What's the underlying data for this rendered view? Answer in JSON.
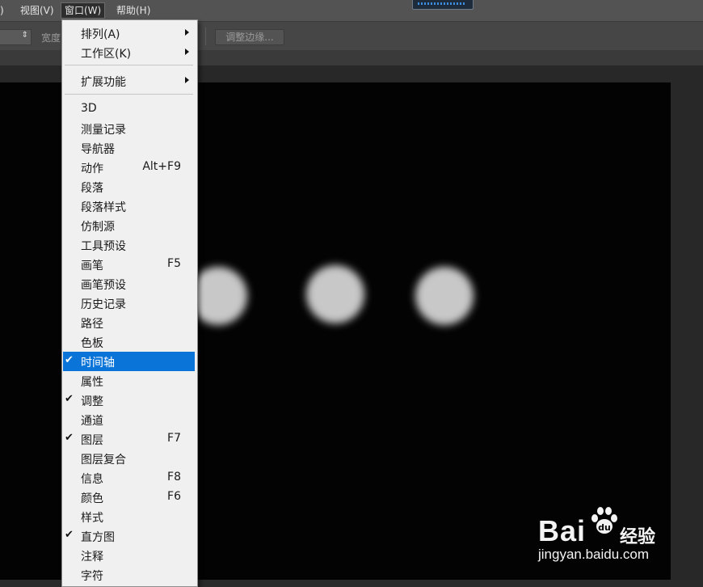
{
  "menubar": {
    "partial_item": ")",
    "view": "视图(V)",
    "window": "窗口(W)",
    "help": "帮助(H)"
  },
  "optionsbar": {
    "width_label": "宽度",
    "refine_edge": "调整边缘..."
  },
  "menu": {
    "top_items": [
      {
        "label": "排列(A)"
      },
      {
        "label": "工作区(K)"
      }
    ],
    "extensions": "扩展功能",
    "items": [
      {
        "label": "3D",
        "shortcut": "",
        "checked": false
      },
      {
        "label": "测量记录",
        "shortcut": "",
        "checked": false
      },
      {
        "label": "导航器",
        "shortcut": "",
        "checked": false
      },
      {
        "label": "动作",
        "shortcut": "Alt+F9",
        "checked": false
      },
      {
        "label": "段落",
        "shortcut": "",
        "checked": false
      },
      {
        "label": "段落样式",
        "shortcut": "",
        "checked": false
      },
      {
        "label": "仿制源",
        "shortcut": "",
        "checked": false
      },
      {
        "label": "工具预设",
        "shortcut": "",
        "checked": false
      },
      {
        "label": "画笔",
        "shortcut": "F5",
        "checked": false
      },
      {
        "label": "画笔预设",
        "shortcut": "",
        "checked": false
      },
      {
        "label": "历史记录",
        "shortcut": "",
        "checked": false
      },
      {
        "label": "路径",
        "shortcut": "",
        "checked": false
      },
      {
        "label": "色板",
        "shortcut": "",
        "checked": false
      },
      {
        "label": "时间轴",
        "shortcut": "",
        "checked": true,
        "highlighted": true
      },
      {
        "label": "属性",
        "shortcut": "",
        "checked": false
      },
      {
        "label": "调整",
        "shortcut": "",
        "checked": true
      },
      {
        "label": "通道",
        "shortcut": "",
        "checked": false
      },
      {
        "label": "图层",
        "shortcut": "F7",
        "checked": true
      },
      {
        "label": "图层复合",
        "shortcut": "",
        "checked": false
      },
      {
        "label": "信息",
        "shortcut": "F8",
        "checked": false
      },
      {
        "label": "颜色",
        "shortcut": "F6",
        "checked": false
      },
      {
        "label": "样式",
        "shortcut": "",
        "checked": false
      },
      {
        "label": "直方图",
        "shortcut": "",
        "checked": true
      },
      {
        "label": "注释",
        "shortcut": "",
        "checked": false
      },
      {
        "label": "字符",
        "shortcut": "",
        "checked": false
      }
    ],
    "checkmark": "✔"
  },
  "watermark": {
    "brand": "Bai",
    "brand_suffix": "经验",
    "url": "jingyan.baidu.com"
  },
  "colors": {
    "highlight": "#0a74d8",
    "menu_bg": "#f0f0f0",
    "canvas": "#030303"
  }
}
